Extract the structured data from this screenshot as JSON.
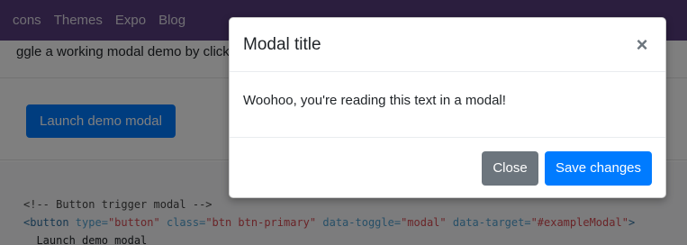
{
  "navbar": {
    "items": [
      "cons",
      "Themes",
      "Expo",
      "Blog"
    ]
  },
  "page": {
    "intro_text": "ggle a working modal demo by clicking the button below. It will slide down and fade in from the top of the p",
    "launch_button": "Launch demo modal"
  },
  "code": {
    "line1": "<!-- Button trigger modal -->",
    "line2_tag_open": "<button",
    "line2_attr1": " type=",
    "line2_val1": "\"button\"",
    "line2_attr2": " class=",
    "line2_val2": "\"btn btn-primary\"",
    "line2_attr3": " data-toggle=",
    "line2_val3": "\"modal\"",
    "line2_attr4": " data-target=",
    "line2_val4": "\"#exampleModal\"",
    "line2_tag_close": ">",
    "line3": "  Launch demo modal"
  },
  "modal": {
    "title": "Modal title",
    "close_symbol": "×",
    "body_text": "Woohoo, you're reading this text in a modal!",
    "close_button": "Close",
    "save_button": "Save changes"
  },
  "colors": {
    "navbar": "#563d7c",
    "primary": "#007bff",
    "secondary": "#6c757d",
    "backdrop": "rgba(0,0,0,0.5)"
  }
}
